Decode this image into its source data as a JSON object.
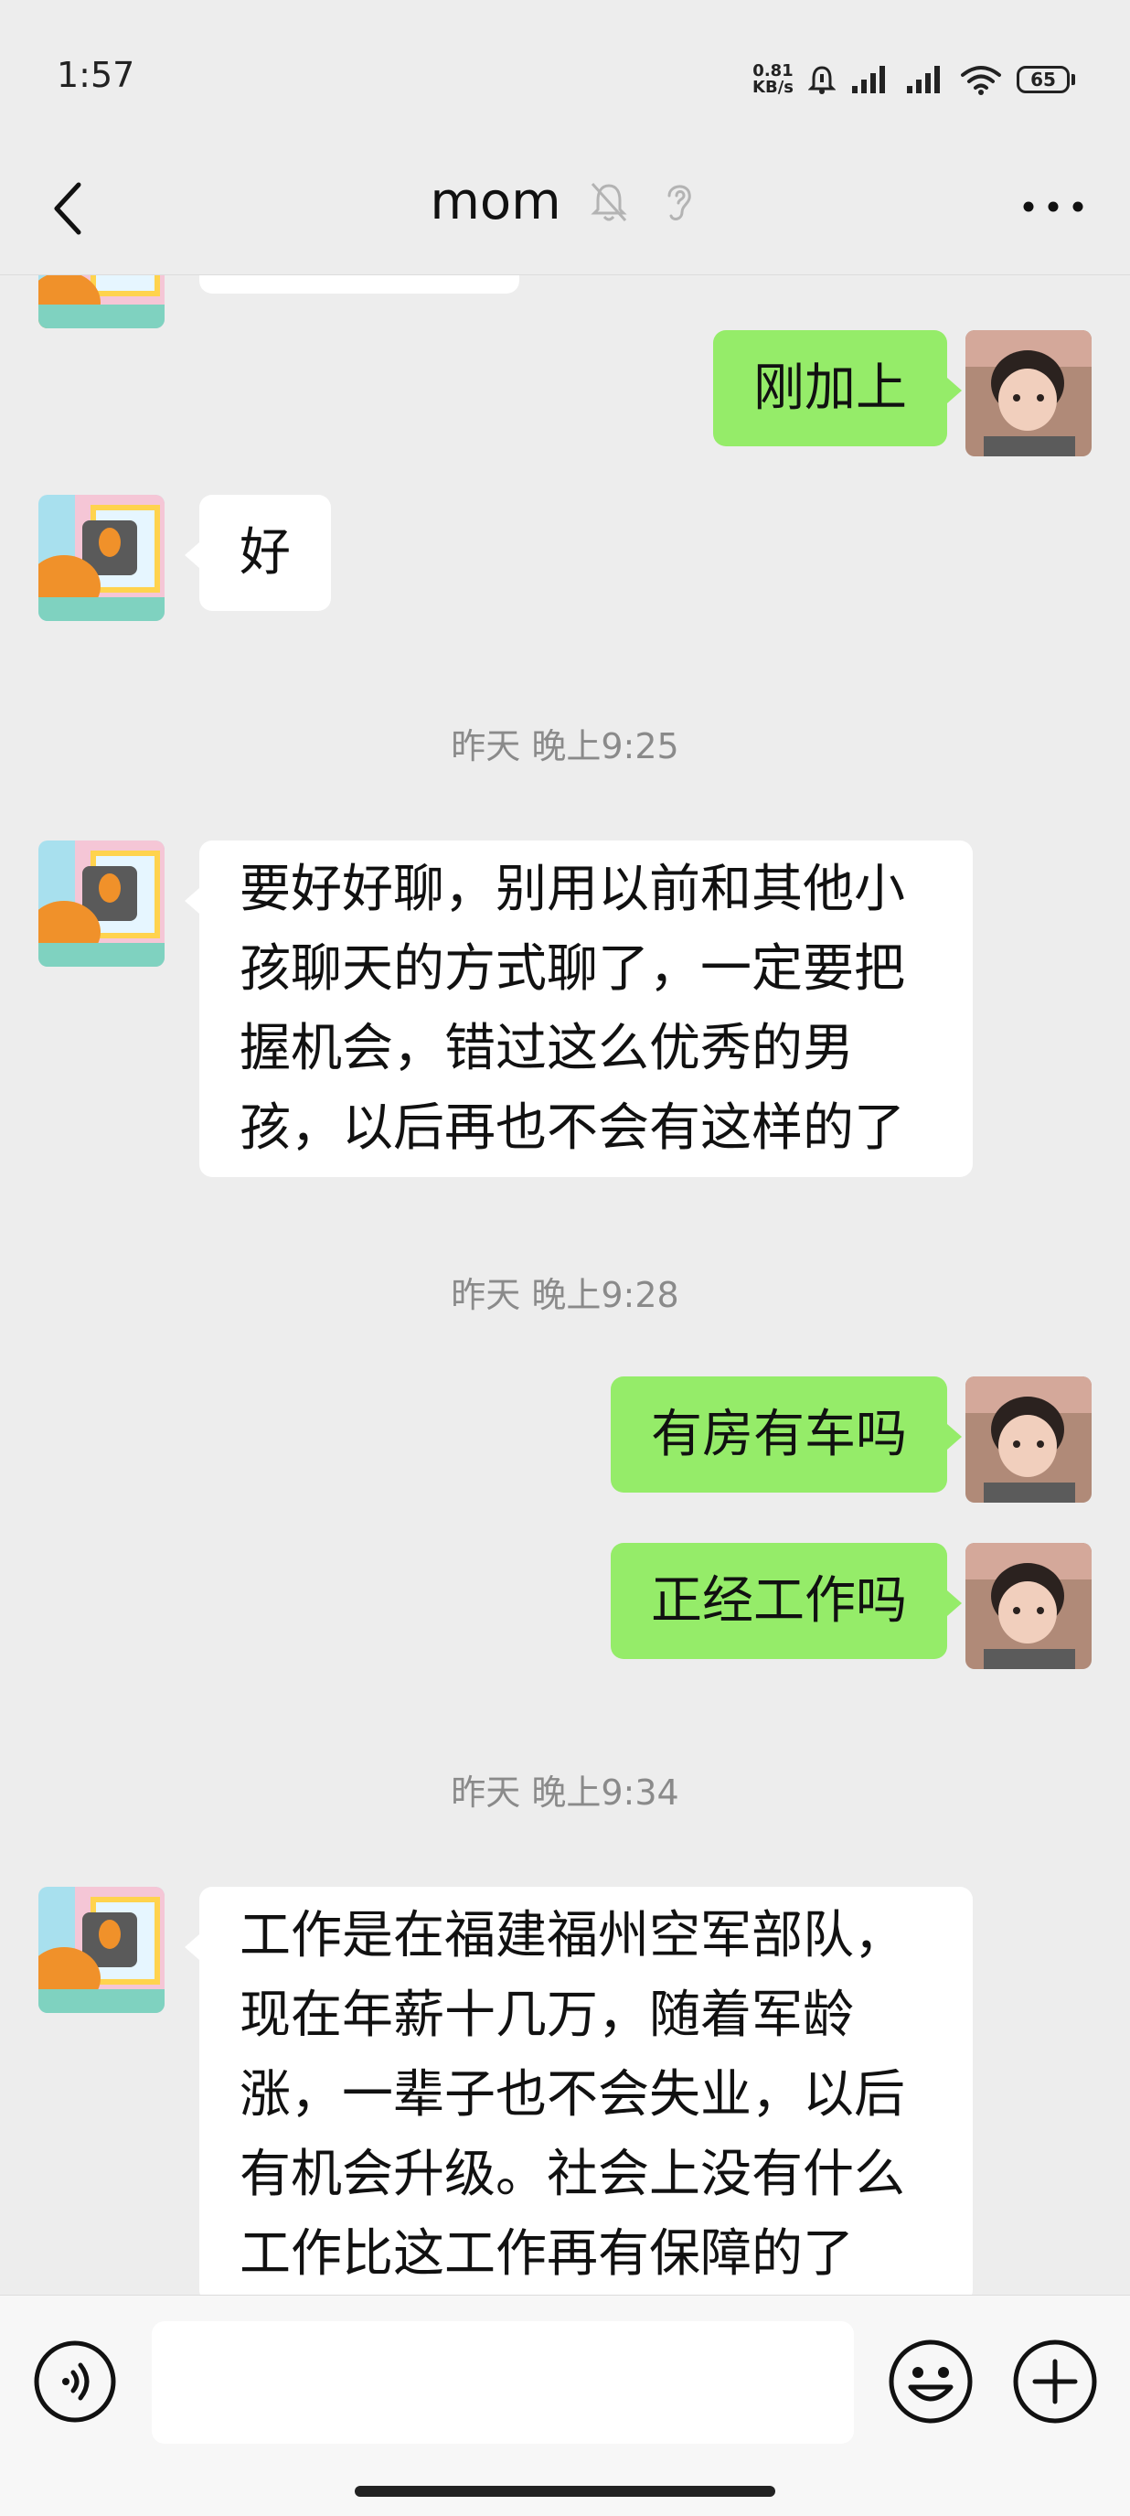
{
  "status_bar": {
    "time": "1:57",
    "net_speed_value": "0.81",
    "net_speed_unit": "KB/s",
    "battery_level": "65"
  },
  "nav": {
    "title": "mom",
    "icons": [
      "back-arrow-icon",
      "mute-bell-icon",
      "ear-icon",
      "more-dots-icon"
    ]
  },
  "messages": [
    {
      "type": "partial_received"
    },
    {
      "type": "sent",
      "text": "刚加上"
    },
    {
      "type": "received",
      "text": "好"
    },
    {
      "type": "timestamp",
      "text": "昨天 晚上9:25"
    },
    {
      "type": "received",
      "text": "要好好聊，别用以前和其他小孩聊天的方式聊了，一定要把握机会，错过这么优秀的男孩，以后再也不会有这样的了"
    },
    {
      "type": "timestamp",
      "text": "昨天 晚上9:28"
    },
    {
      "type": "sent",
      "text": "有房有车吗"
    },
    {
      "type": "sent",
      "text": "正经工作吗"
    },
    {
      "type": "timestamp",
      "text": "昨天 晚上9:34"
    },
    {
      "type": "received",
      "text": "工作是在福建福州空军部队，现在年薪十几万，随着军龄涨，一辈子也不会失业，以后有机会升级。社会上没有什么工作比这工作再有保障的了"
    }
  ],
  "input_bar": {
    "value": "",
    "icons": [
      "voice-icon",
      "emoji-icon",
      "plus-icon"
    ]
  },
  "colors": {
    "background": "#ededed",
    "sent_bubble": "#95ec69",
    "received_bubble": "#ffffff",
    "timestamp_text": "#8a8a8a"
  }
}
